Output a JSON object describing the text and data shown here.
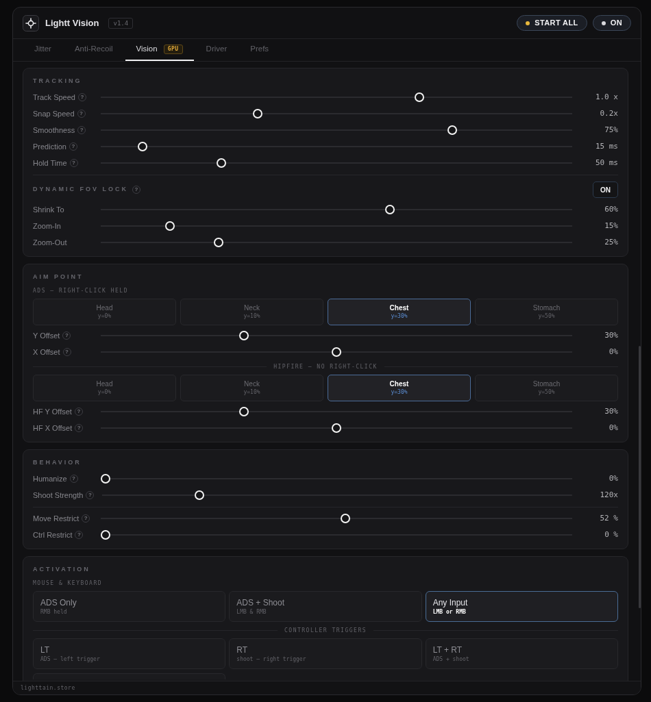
{
  "window": {
    "title": "Lightt Vision",
    "version": "v1.4"
  },
  "header_buttons": [
    {
      "label": "START ALL",
      "color": "#e8b83c"
    },
    {
      "label": "ON",
      "color": "#d8d8dc"
    }
  ],
  "tabs": [
    {
      "label": "Jitter",
      "selected": false
    },
    {
      "label": "Anti-Recoil",
      "selected": false
    },
    {
      "label": "Vision",
      "selected": true,
      "badge": "GPU"
    },
    {
      "label": "Driver",
      "selected": false
    },
    {
      "label": "Prefs",
      "selected": false
    }
  ],
  "sections": [
    {
      "title": "TRACKING",
      "items": [
        {
          "kind": "slider",
          "label": "Track Speed",
          "help": "?",
          "level": 0.68,
          "reading": "1.0 x"
        },
        {
          "kind": "slider",
          "label": "Snap Speed",
          "help": "?",
          "level": 0.33,
          "reading": "0.2x"
        },
        {
          "kind": "slider",
          "label": "Smoothness",
          "help": "?",
          "level": 0.75,
          "reading": "75%"
        },
        {
          "kind": "slider",
          "label": "Prediction",
          "help": "?",
          "level": 0.08,
          "reading": "15 ms"
        },
        {
          "kind": "slider",
          "label": "Hold Time",
          "help": "?",
          "level": 0.25,
          "reading": "50 ms"
        },
        {
          "kind": "divider"
        },
        {
          "kind": "toggle_heading",
          "label": "DYNAMIC FOV LOCK",
          "help": "?",
          "toggle": "ON",
          "on": true
        },
        {
          "kind": "slider",
          "label": "Shrink To",
          "level": 0.615,
          "reading": "60%"
        },
        {
          "kind": "slider",
          "label": "Zoom-In",
          "level": 0.14,
          "reading": "15%"
        },
        {
          "kind": "slider",
          "label": "Zoom-Out",
          "level": 0.245,
          "reading": "25%"
        }
      ]
    },
    {
      "title": "AIM POINT",
      "items": [
        {
          "kind": "caption",
          "label": "ADS — RIGHT-CLICK HELD"
        },
        {
          "kind": "aim_choices",
          "options": [
            {
              "label": "Head",
              "sub": "y=0%",
              "selected": false
            },
            {
              "label": "Neck",
              "sub": "y=10%",
              "selected": false
            },
            {
              "label": "Chest",
              "sub": "y=30%",
              "selected": true
            },
            {
              "label": "Stomach",
              "sub": "y=50%",
              "selected": false
            }
          ]
        },
        {
          "kind": "slider",
          "label": "Y Offset",
          "help": "?",
          "level": 0.3,
          "reading": "30%"
        },
        {
          "kind": "slider",
          "label": "X Offset",
          "help": "?",
          "level": 0.5,
          "reading": "0%"
        },
        {
          "kind": "rule_caption",
          "label": "HIPFIRE — NO RIGHT-CLICK"
        },
        {
          "kind": "aim_choices",
          "options": [
            {
              "label": "Head",
              "sub": "y=0%",
              "selected": false
            },
            {
              "label": "Neck",
              "sub": "y=10%",
              "selected": false
            },
            {
              "label": "Chest",
              "sub": "y=30%",
              "selected": true
            },
            {
              "label": "Stomach",
              "sub": "y=50%",
              "selected": false
            }
          ]
        },
        {
          "kind": "slider",
          "label": "HF Y Offset",
          "help": "?",
          "level": 0.3,
          "reading": "30%"
        },
        {
          "kind": "slider",
          "label": "HF X Offset",
          "help": "?",
          "level": 0.5,
          "reading": "0%"
        }
      ]
    },
    {
      "title": "BEHAVIOR",
      "items": [
        {
          "kind": "slider",
          "label": "Humanize",
          "help": "?",
          "level": 0,
          "reading": "0%"
        },
        {
          "kind": "slider",
          "label": "Shoot Strength",
          "help": "?",
          "level": 0.2,
          "reading": "120x"
        },
        {
          "kind": "divider"
        },
        {
          "kind": "slider",
          "label": "Move Restrict",
          "help": "?",
          "level": 0.52,
          "reading": "52 %"
        },
        {
          "kind": "slider",
          "label": "Ctrl Restrict",
          "help": "?",
          "level": 0,
          "reading": "0 %"
        }
      ]
    },
    {
      "title": "ACTIVATION",
      "items": [
        {
          "kind": "caption",
          "label": "MOUSE & KEYBOARD"
        },
        {
          "kind": "mode_choices",
          "options": [
            {
              "label": "ADS Only",
              "sub": "RMB held",
              "selected": false
            },
            {
              "label": "ADS + Shoot",
              "sub": "LMB & RMB",
              "selected": false
            },
            {
              "label": "Any Input",
              "sub": "LMB or RMB",
              "selected": true
            }
          ]
        },
        {
          "kind": "rule_caption",
          "label": "CONTROLLER TRIGGERS"
        },
        {
          "kind": "mode_choices",
          "options": [
            {
              "label": "LT",
              "sub": "ADS — left trigger",
              "selected": false
            },
            {
              "label": "RT",
              "sub": "shoot — right trigger",
              "selected": false
            },
            {
              "label": "LT + RT",
              "sub": "ADS + shoot",
              "selected": false
            },
            {
              "selected": false
            }
          ]
        }
      ]
    }
  ],
  "footer": {
    "text": "lighttain.store"
  }
}
